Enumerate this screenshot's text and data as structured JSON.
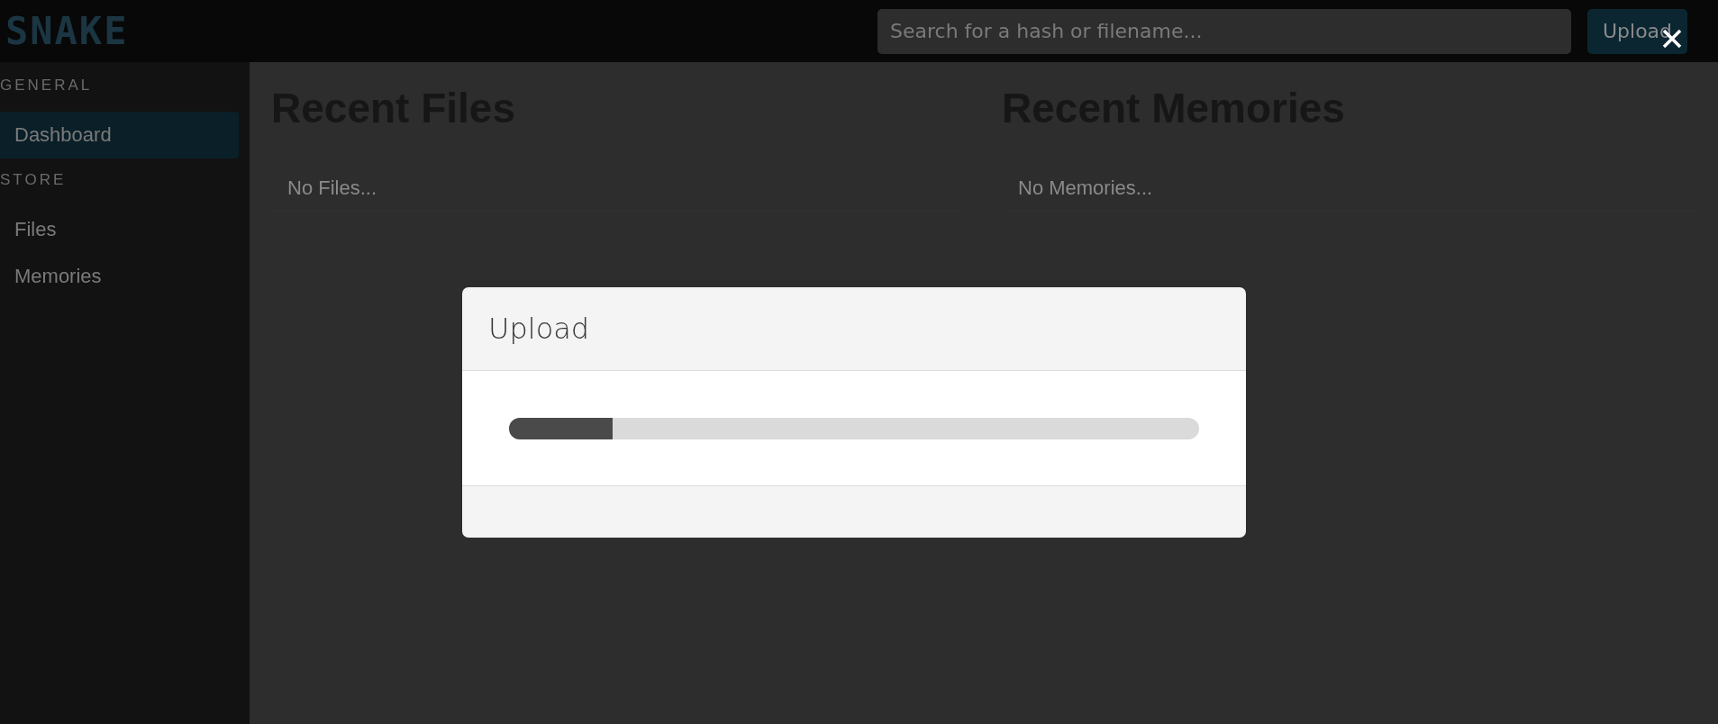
{
  "header": {
    "logo": "SNAKE",
    "search": {
      "placeholder": "Search for a hash or filename..."
    },
    "upload_button": "Upload"
  },
  "sidebar": {
    "sections": [
      {
        "label": "GENERAL",
        "items": [
          {
            "label": "Dashboard",
            "selected": true
          }
        ]
      },
      {
        "label": "STORE",
        "items": [
          {
            "label": "Files",
            "selected": false
          },
          {
            "label": "Memories",
            "selected": false
          }
        ]
      }
    ]
  },
  "panels": [
    {
      "title": "Recent Files",
      "empty_text": "No Files..."
    },
    {
      "title": "Recent Memories",
      "empty_text": "No Memories..."
    }
  ],
  "modal": {
    "title": "Upload",
    "progress": {
      "level": 0.15
    }
  }
}
